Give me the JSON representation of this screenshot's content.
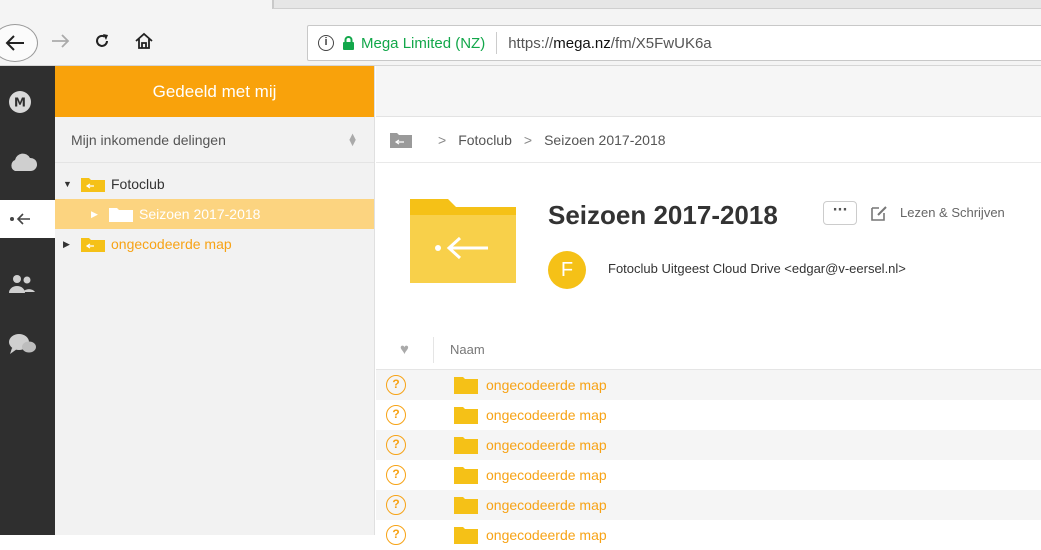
{
  "browser": {
    "owner": "Mega Limited (NZ)",
    "url_prefix": "https://",
    "url_domain": "mega.nz",
    "url_path": "/fm/X5FwUK6a",
    "info_glyph": "i"
  },
  "rail": {
    "items": [
      {
        "icon": "mega-logo-icon",
        "label": "M"
      },
      {
        "icon": "cloud-icon"
      },
      {
        "icon": "incoming-shares-icon"
      },
      {
        "icon": "contacts-icon"
      },
      {
        "icon": "chat-icon"
      }
    ]
  },
  "sidebar": {
    "header": "Gedeeld met mij",
    "subheader": "Mijn inkomende delingen",
    "tree": [
      {
        "label": "Fotoclub",
        "expanded": true,
        "level": 0
      },
      {
        "label": "Seizoen 2017-2018",
        "selected": true,
        "level": 1
      },
      {
        "label": "ongecodeerde map",
        "level": 0,
        "color": "#f7a316"
      }
    ]
  },
  "breadcrumb": {
    "items": [
      "Fotoclub",
      "Seizoen 2017-2018"
    ],
    "separator": ">"
  },
  "folder_info": {
    "title": "Seizoen 2017-2018",
    "menu_label": "···",
    "permission": "Lezen & Schrijven",
    "avatar_letter": "F",
    "owner": "Fotoclub Uitgeest Cloud Drive <edgar@v-eersel.nl>"
  },
  "list": {
    "header_name": "Naam",
    "favorite_glyph": "♥",
    "rows": [
      {
        "name": "ongecodeerde map",
        "status": "?"
      },
      {
        "name": "ongecodeerde map",
        "status": "?"
      },
      {
        "name": "ongecodeerde map",
        "status": "?"
      },
      {
        "name": "ongecodeerde map",
        "status": "?"
      },
      {
        "name": "ongecodeerde map",
        "status": "?"
      },
      {
        "name": "ongecodeerde map",
        "status": "?"
      }
    ]
  },
  "colors": {
    "accent": "#f9a20b",
    "folder": "#f5c117",
    "link": "#f7a316",
    "rail": "#2f2f2f",
    "secure": "#12a74a"
  }
}
